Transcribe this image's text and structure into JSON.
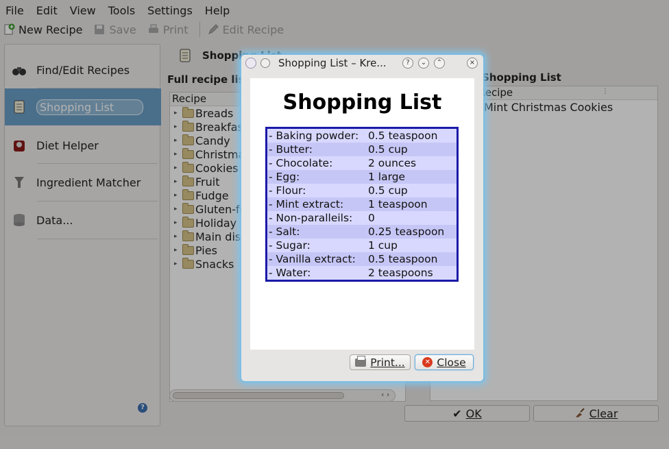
{
  "menu": [
    "File",
    "Edit",
    "View",
    "Tools",
    "Settings",
    "Help"
  ],
  "toolbar": {
    "new_recipe": "New Recipe",
    "save": "Save",
    "print": "Print",
    "edit_recipe": "Edit Recipe"
  },
  "sidebar": {
    "items": [
      {
        "label": "Find/Edit Recipes",
        "icon": "binoculars-icon"
      },
      {
        "label": "Shopping List",
        "icon": "notepad-icon"
      },
      {
        "label": "Diet Helper",
        "icon": "diet-icon"
      },
      {
        "label": "Ingredient Matcher",
        "icon": "funnel-icon"
      },
      {
        "label": "Data...",
        "icon": "database-icon"
      }
    ],
    "help_icon": "?"
  },
  "main": {
    "pane_title": "Shopping List",
    "full_recipe_list_title": "Full recipe list",
    "tree_header": "Recipe",
    "categories": [
      "Breads",
      "Breakfast",
      "Candy",
      "Christmas",
      "Cookies",
      "Fruit",
      "Fudge",
      "Gluten-free",
      "Holiday",
      "Main dish",
      "Pies",
      "Snacks"
    ],
    "shopping_list_title": "Shopping List",
    "shopping_header": "Recipe",
    "shopping_recipes": [
      "Mint Christmas Cookies"
    ],
    "ok_label": "OK",
    "clear_label": "Clear"
  },
  "dialog": {
    "title": "Shopping List – Kre...",
    "heading": "Shopping List",
    "items": [
      {
        "name": "- Baking powder:",
        "qty": "0.5 teaspoon"
      },
      {
        "name": "- Butter:",
        "qty": "0.5 cup"
      },
      {
        "name": "- Chocolate:",
        "qty": "2 ounces"
      },
      {
        "name": "- Egg:",
        "qty": "1 large"
      },
      {
        "name": "- Flour:",
        "qty": "0.5 cup"
      },
      {
        "name": "- Mint extract:",
        "qty": "1 teaspoon"
      },
      {
        "name": "- Non-paralleils:",
        "qty": "0"
      },
      {
        "name": "- Salt:",
        "qty": "0.25 teaspoon"
      },
      {
        "name": "- Sugar:",
        "qty": "1 cup"
      },
      {
        "name": "- Vanilla extract:",
        "qty": "0.5 teaspoon"
      },
      {
        "name": "- Water:",
        "qty": "2 teaspoons"
      }
    ],
    "print_label": "Print...",
    "close_label": "Close"
  },
  "colors": {
    "accent": "#6aa0c8",
    "table_border": "#1a1aa8",
    "table_row": "#d8d8ff",
    "table_row_alt": "#c6c6f6",
    "dialog_glow": "#7fc4ec"
  }
}
